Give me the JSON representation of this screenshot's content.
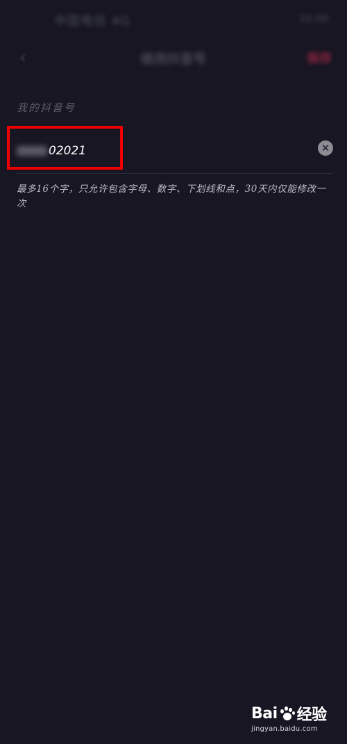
{
  "status_bar": {
    "left_text": "中国电信 4G",
    "right_text": "10:00"
  },
  "nav": {
    "back_icon": "chevron-left-icon",
    "title": "修改抖音号",
    "save_label": "保存"
  },
  "form": {
    "section_label": "我的抖音号",
    "input_value": "02021",
    "clear_icon": "close-circle-icon",
    "hint": "最多16个字，只允许包含字母、数字、下划线和点，30天内仅能修改一次"
  },
  "watermark": {
    "brand_left": "Bai",
    "brand_right": "经验",
    "url": "jingyan.baidu.com"
  },
  "colors": {
    "background": "#171622",
    "highlight": "#ee0000",
    "save": "#8c2340"
  }
}
